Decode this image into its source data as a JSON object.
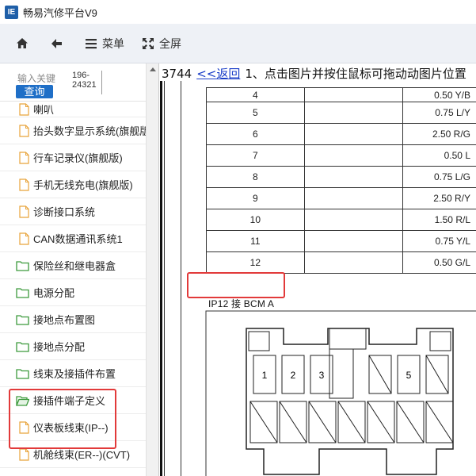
{
  "window": {
    "title": "畅易汽修平台V9",
    "app_icon_text": "IE"
  },
  "toolbar": {
    "home": "home-icon",
    "back": "back-arrow-icon",
    "menu_label": "菜单",
    "fullscreen_label": "全屏"
  },
  "sidebar": {
    "search_placeholder": "输入关键",
    "search_button": "查询",
    "vin_line1": "196-",
    "vin_line2": "24321",
    "items": [
      {
        "label": "喇叭",
        "kind": "doc"
      },
      {
        "label": "抬头数字显示系统(旗舰版)",
        "kind": "doc"
      },
      {
        "label": "行车记录仪(旗舰版)",
        "kind": "doc"
      },
      {
        "label": "手机无线充电(旗舰版)",
        "kind": "doc"
      },
      {
        "label": "诊断接口系统",
        "kind": "doc"
      },
      {
        "label": "CAN数据通讯系统1",
        "kind": "doc"
      },
      {
        "label": "保险丝和继电器盒",
        "kind": "folder"
      },
      {
        "label": "电源分配",
        "kind": "folder"
      },
      {
        "label": "接地点布置图",
        "kind": "folder"
      },
      {
        "label": "接地点分配",
        "kind": "folder"
      },
      {
        "label": "线束及接插件布置",
        "kind": "folder"
      },
      {
        "label": "接插件端子定义",
        "kind": "folder-open"
      },
      {
        "label": "仪表板线束(IP--)",
        "kind": "doc"
      },
      {
        "label": "机舱线束(ER--)(CVT)",
        "kind": "doc"
      }
    ]
  },
  "content": {
    "doc_id": "3744",
    "back_link": "<<返回",
    "instruction": "1、点击图片并按住鼠标可拖动动图片位置",
    "pin_rows": [
      {
        "pin": "4",
        "spec": "0.50 Y/B"
      },
      {
        "pin": "5",
        "spec": "0.75 L/Y"
      },
      {
        "pin": "6",
        "spec": "2.50 R/G"
      },
      {
        "pin": "7",
        "spec": "0.50 L"
      },
      {
        "pin": "8",
        "spec": "0.75 L/G"
      },
      {
        "pin": "9",
        "spec": "2.50 R/Y"
      },
      {
        "pin": "10",
        "spec": "1.50 R/L"
      },
      {
        "pin": "11",
        "spec": "0.75 Y/L"
      },
      {
        "pin": "12",
        "spec": "0.50 G/L"
      }
    ],
    "connector_title": "IP12 接 BCM A",
    "connector_pins": [
      "1",
      "2",
      "3",
      "5"
    ]
  },
  "colors": {
    "highlight": "#e23a3a",
    "link": "#1a3ec8",
    "button": "#1f6fc7"
  }
}
